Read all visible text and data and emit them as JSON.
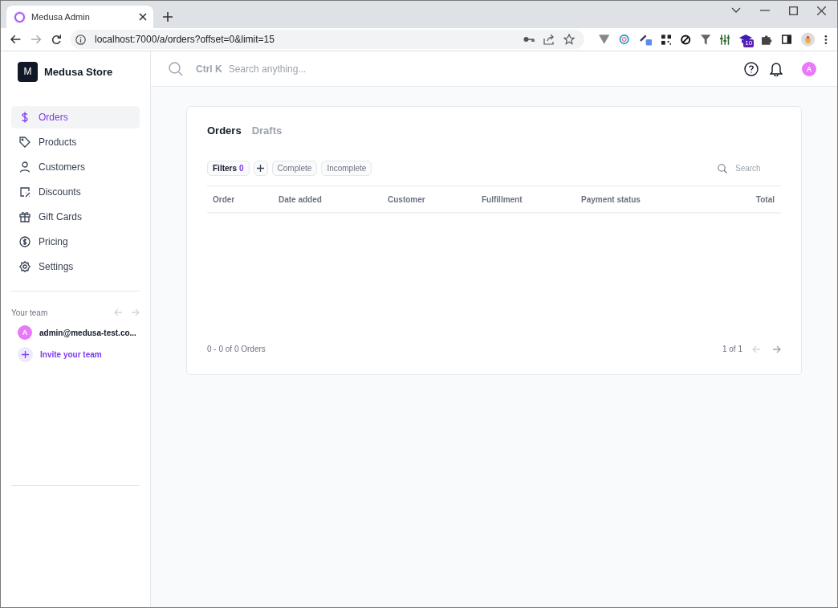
{
  "browser": {
    "tab_title": "Medusa Admin",
    "url": "localhost:7000/a/orders?offset=0&limit=15",
    "extension_badge": "10"
  },
  "store": {
    "logo_letter": "M",
    "name": "Medusa Store"
  },
  "search": {
    "shortcut": "Ctrl K",
    "placeholder": "Search anything..."
  },
  "user": {
    "avatar_letter": "A"
  },
  "sidebar": {
    "items": [
      {
        "label": "Orders",
        "selected": true
      },
      {
        "label": "Products",
        "selected": false
      },
      {
        "label": "Customers",
        "selected": false
      },
      {
        "label": "Discounts",
        "selected": false
      },
      {
        "label": "Gift Cards",
        "selected": false
      },
      {
        "label": "Pricing",
        "selected": false
      },
      {
        "label": "Settings",
        "selected": false
      }
    ],
    "team": {
      "title": "Your team",
      "members": [
        {
          "avatar_letter": "A",
          "email": "admin@medusa-test.co..."
        }
      ],
      "invite": "Invite your team"
    }
  },
  "tabs": [
    {
      "label": "Orders",
      "selected": true
    },
    {
      "label": "Drafts",
      "selected": false
    }
  ],
  "filters": {
    "label": "Filters",
    "count": "0",
    "chips": [
      {
        "label": "Complete",
        "selected": false
      },
      {
        "label": "Incomplete",
        "selected": false
      }
    ],
    "search_placeholder": "Search"
  },
  "table": {
    "columns": [
      "Order",
      "Date added",
      "Customer",
      "Fulfillment",
      "Payment status",
      "Total"
    ]
  },
  "footer": {
    "summary": "0 - 0 of 0 Orders",
    "page": "1 of 1"
  }
}
